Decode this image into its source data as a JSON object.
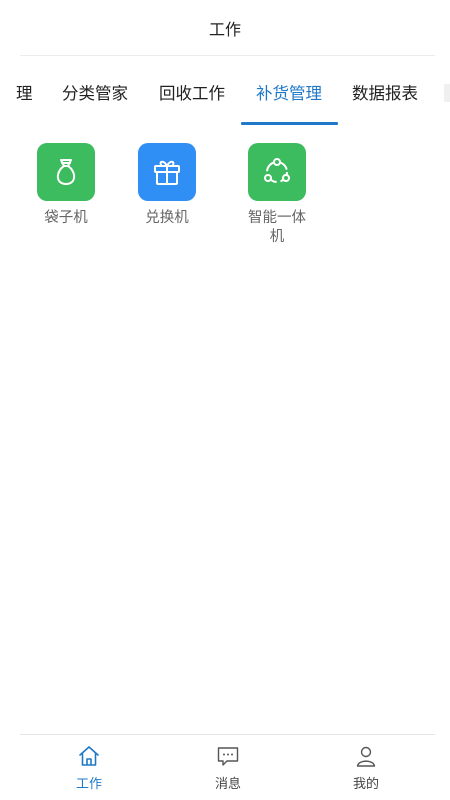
{
  "header": {
    "title": "工作"
  },
  "tabs": [
    {
      "label": "理",
      "active": false
    },
    {
      "label": "分类管家",
      "active": false
    },
    {
      "label": "回收工作",
      "active": false
    },
    {
      "label": "补货管理",
      "active": true
    },
    {
      "label": "数据报表",
      "active": false
    }
  ],
  "grid": [
    {
      "label": "袋子机",
      "icon": "money-bag-icon",
      "color": "#3dbb5f"
    },
    {
      "label": "兑换机",
      "icon": "gift-box-icon",
      "color": "#2f8ff5"
    },
    {
      "label": "智能一体机",
      "icon": "share-cycle-icon",
      "color": "#3dbb5f"
    }
  ],
  "bottom_nav": [
    {
      "label": "工作",
      "icon": "home-icon",
      "active": true
    },
    {
      "label": "消息",
      "icon": "message-icon",
      "active": false
    },
    {
      "label": "我的",
      "icon": "user-icon",
      "active": false
    }
  ],
  "colors": {
    "accent": "#1f78c9",
    "green": "#3dbb5f",
    "blue": "#2f8ff5"
  }
}
